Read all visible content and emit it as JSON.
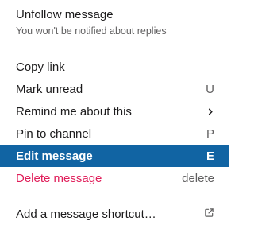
{
  "menu": {
    "header": {
      "title": "Unfollow message",
      "subtitle": "You won't be notified about replies"
    },
    "items": [
      {
        "label": "Copy link",
        "shortcut": ""
      },
      {
        "label": "Mark unread",
        "shortcut": "U"
      },
      {
        "label": "Remind me about this",
        "shortcut": "",
        "icon": "chevron-right-icon"
      },
      {
        "label": "Pin to channel",
        "shortcut": "P"
      },
      {
        "label": "Edit message",
        "shortcut": "E",
        "highlighted": true
      },
      {
        "label": "Delete message",
        "shortcut": "delete",
        "danger": true
      }
    ],
    "footer_item": {
      "label": "Add a message shortcut…",
      "icon": "external-link-icon"
    }
  },
  "colors": {
    "highlight": "#1164a3",
    "danger": "#e01e5a",
    "text": "#1d1c1d",
    "muted": "#616061",
    "divider": "#dddddd"
  }
}
